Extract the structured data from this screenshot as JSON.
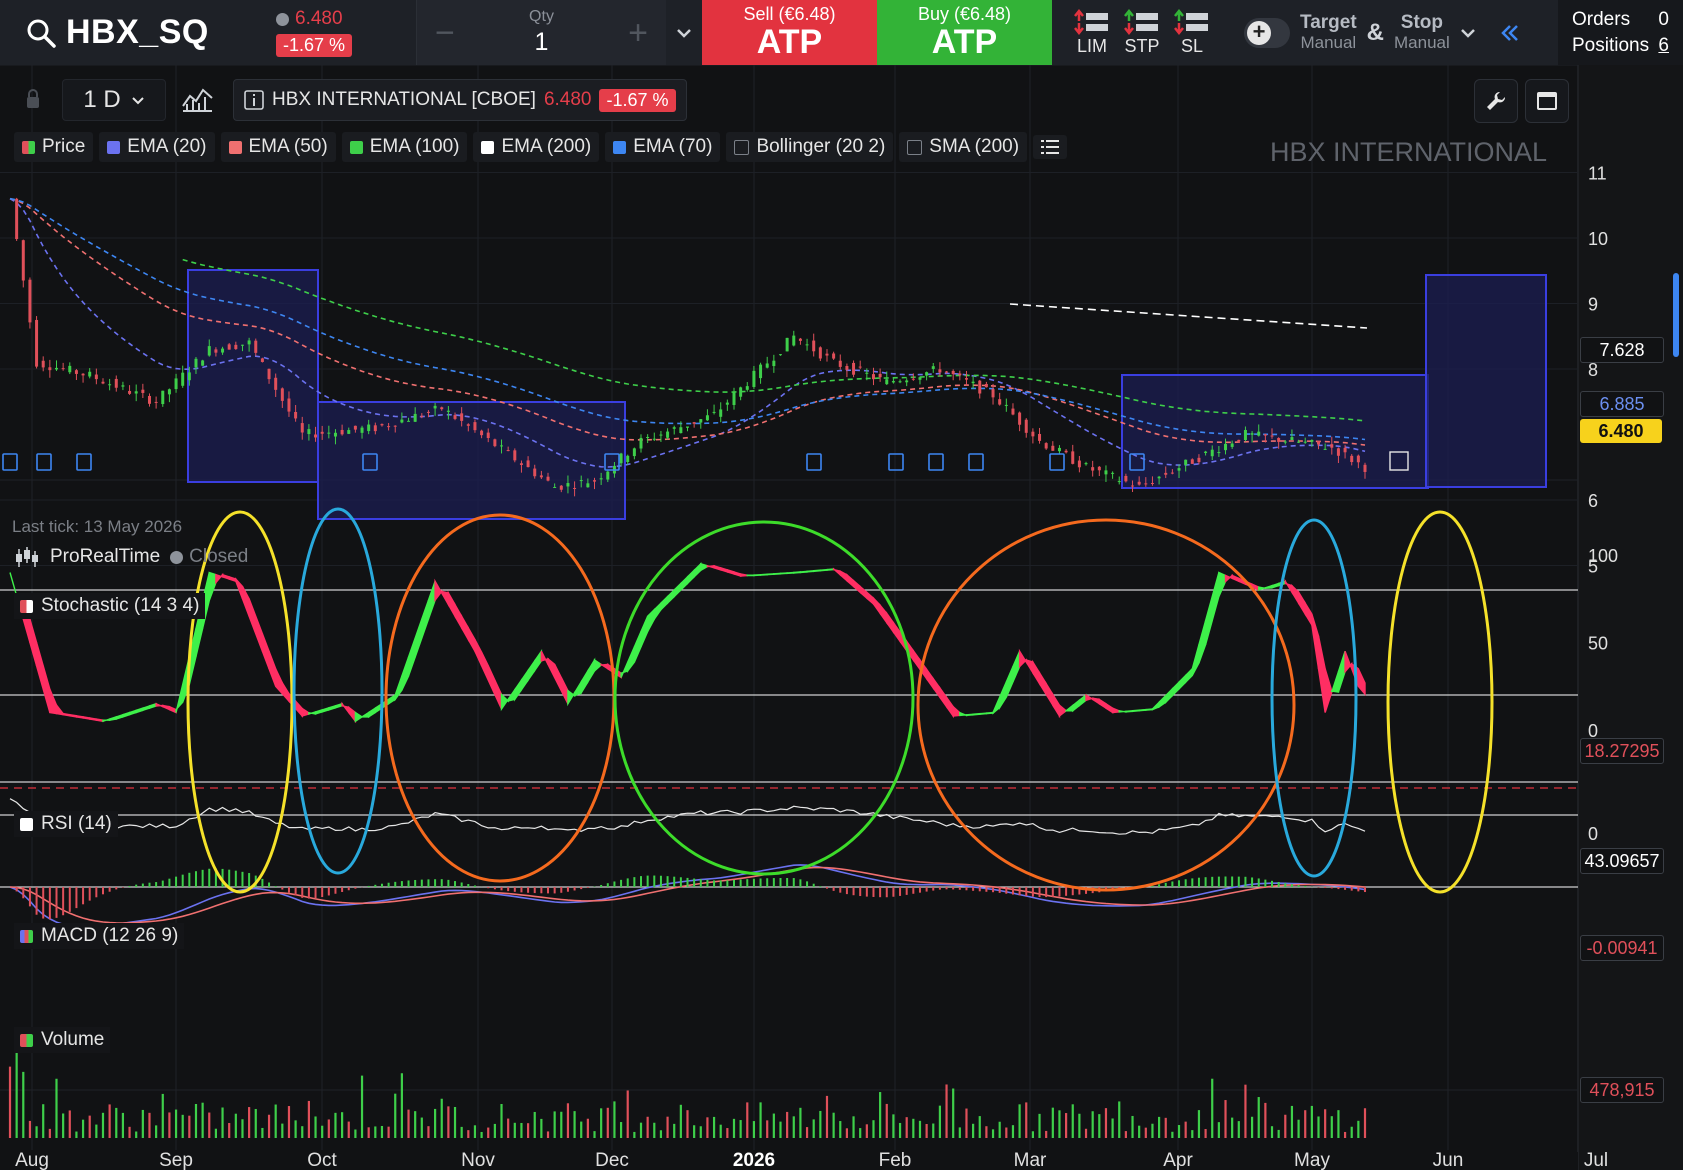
{
  "toolbar": {
    "symbol": "HBX_SQ",
    "last_price": "6.480",
    "change_pct": "-1.67 %",
    "qty_label": "Qty",
    "qty_value": "1",
    "qty_minus": "−",
    "qty_plus": "+",
    "sell_label": "Sell (€6.48)",
    "sell_action": "ATP",
    "buy_label": "Buy (€6.48)",
    "buy_action": "ATP",
    "order_types": [
      "LIM",
      "STP",
      "SL"
    ],
    "target_label": "Target",
    "target_mode": "Manual",
    "amp": "&",
    "stop_label": "Stop",
    "stop_mode": "Manual",
    "orders_label": "Orders",
    "orders_count": "0",
    "positions_label": "Positions",
    "positions_count": "6"
  },
  "chart_header": {
    "timeframe": "1 D",
    "instrument": "HBX INTERNATIONAL [CBOE]",
    "price": "6.480",
    "change_pct": "-1.67 %",
    "watermark": "HBX INTERNATIONAL"
  },
  "legend": [
    {
      "label": "Price",
      "color": "#e0505a",
      "color2": "#3ecf4a"
    },
    {
      "label": "EMA (20)",
      "color": "#6b72f0"
    },
    {
      "label": "EMA (50)",
      "color": "#f07070"
    },
    {
      "label": "EMA (100)",
      "color": "#3ecf4a"
    },
    {
      "label": "EMA (200)",
      "color": "#ffffff"
    },
    {
      "label": "EMA (70)",
      "color": "#3d86f2"
    },
    {
      "label": "Bollinger (20 2)",
      "color": ""
    },
    {
      "label": "SMA (200)",
      "color": ""
    }
  ],
  "status": {
    "last_tick": "Last tick: 13 May 2026",
    "source": "ProRealTime",
    "market_state": "Closed"
  },
  "indicators": {
    "stochastic": "Stochastic (14 3 4)",
    "rsi": "RSI (14)",
    "macd": "MACD (12 26 9)",
    "volume": "Volume"
  },
  "right_axis": {
    "price_ticks": [
      "11",
      "10",
      "9",
      "8",
      "6",
      "5"
    ],
    "stoch_ticks": [
      "100",
      "50",
      "0"
    ],
    "rsi_ticks": [
      "0"
    ],
    "tags": {
      "ema_a": "7.628",
      "ema_b": "6.885",
      "last": "6.480",
      "stoch": "18.27295",
      "rsi": "43.09657",
      "macd": "-0.00941",
      "volume": "478,915"
    }
  },
  "x_axis": [
    "Aug",
    "Sep",
    "Oct",
    "Nov",
    "Dec",
    "2026",
    "Feb",
    "Mar",
    "Apr",
    "May",
    "Jun",
    "Jul"
  ],
  "colors": {
    "up": "#3ecf4a",
    "down": "#e0505a",
    "stoch_fill_up": "#3ef04a",
    "stoch_fill_down": "#ff2e63",
    "zone_fill": "#1b1d52",
    "zone_stroke": "#3a3ee0",
    "circle_yellow": "#f5e12a",
    "circle_blue": "#29a9dc",
    "circle_orange": "#f56a1e",
    "circle_green": "#3ddc2a"
  }
}
